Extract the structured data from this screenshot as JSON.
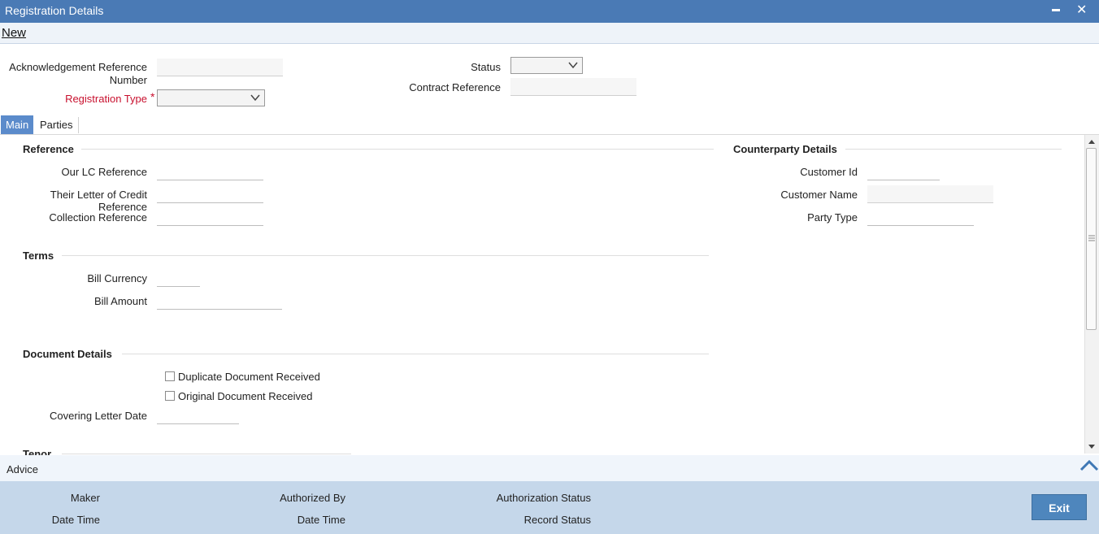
{
  "window": {
    "title": "Registration Details",
    "minimize": "▬",
    "close": "✕"
  },
  "toolbar": {
    "new_label": "New"
  },
  "header": {
    "ack_ref_label_1": "Acknowledgement Reference",
    "ack_ref_label_2": "Number",
    "ack_ref_value": "",
    "reg_type_label": "Registration Type",
    "required_mark": "*",
    "reg_type_value": "",
    "status_label": "Status",
    "status_value": "",
    "contract_ref_label": "Contract Reference",
    "contract_ref_value": ""
  },
  "tabs": [
    {
      "label": "Main"
    },
    {
      "label": "Parties"
    }
  ],
  "reference": {
    "title": "Reference",
    "our_lc_label": "Our LC Reference",
    "their_lc_label": "Their Letter of Credit Reference",
    "collection_label": "Collection Reference"
  },
  "counterparty": {
    "title": "Counterparty Details",
    "customer_id_label": "Customer Id",
    "customer_name_label": "Customer Name",
    "party_type_label": "Party Type"
  },
  "terms": {
    "title": "Terms",
    "bill_currency_label": "Bill Currency",
    "bill_amount_label": "Bill Amount"
  },
  "documents": {
    "title": "Document Details",
    "duplicate_label": "Duplicate Document Received",
    "original_label": "Original Document Received",
    "covering_letter_label": "Covering Letter Date"
  },
  "tenor": {
    "title": "Tenor"
  },
  "advice": {
    "label": "Advice",
    "icon": "chevron-up-icon"
  },
  "footer": {
    "maker": "Maker",
    "date_time_1": "Date Time",
    "authorized_by": "Authorized By",
    "date_time_2": "Date Time",
    "authorization_status": "Authorization Status",
    "record_status": "Record Status",
    "exit_label": "Exit"
  },
  "colors": {
    "titlebar": "#4a7ab5",
    "active_tab": "#5b8bcb",
    "footer": "#c5d7ea",
    "required": "#c8102e"
  }
}
